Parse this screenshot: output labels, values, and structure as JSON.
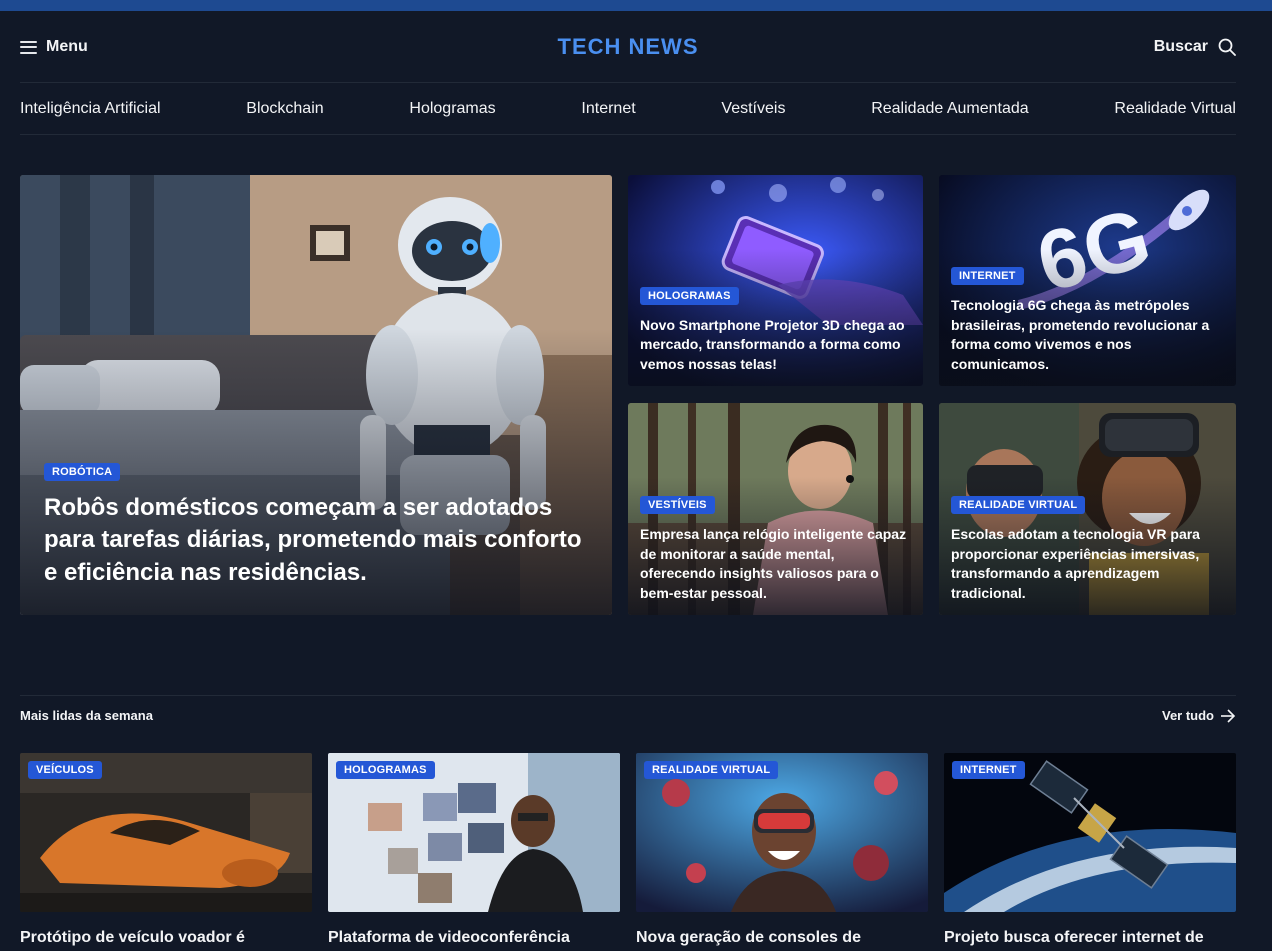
{
  "header": {
    "menu_label": "Menu",
    "logo": "TECH NEWS",
    "search_label": "Buscar"
  },
  "categories": [
    "Inteligência Artificial",
    "Blockchain",
    "Hologramas",
    "Internet",
    "Vestíveis",
    "Realidade Aumentada",
    "Realidade Virtual"
  ],
  "featured": {
    "main": {
      "tag": "ROBÓTICA",
      "title": "Robôs domésticos começam a ser adotados para tarefas diárias, prometendo mais conforto e eficiência nas residências."
    },
    "side": [
      {
        "tag": "HOLOGRAMAS",
        "title": "Novo Smartphone Projetor 3D chega ao mercado, transformando a forma como vemos nossas telas!"
      },
      {
        "tag": "INTERNET",
        "title": "Tecnologia 6G chega às metrópoles brasileiras, prometendo revolucionar a forma como vivemos e nos comunicamos."
      },
      {
        "tag": "VESTÍVEIS",
        "title": "Empresa lança relógio inteligente capaz de monitorar a saúde mental, oferecendo insights valiosos para o bem-estar pessoal."
      },
      {
        "tag": "REALIDADE VIRTUAL",
        "title": "Escolas adotam a tecnologia VR para proporcionar experiências imersivas, transformando a aprendizagem tradicional."
      }
    ]
  },
  "most_read": {
    "title": "Mais lidas da semana",
    "see_all": "Ver tudo",
    "items": [
      {
        "tag": "VEÍCULOS",
        "title": "Protótipo de veículo voador é"
      },
      {
        "tag": "HOLOGRAMAS",
        "title": "Plataforma de videoconferência"
      },
      {
        "tag": "REALIDADE VIRTUAL",
        "title": "Nova geração de consoles de"
      },
      {
        "tag": "INTERNET",
        "title": "Projeto busca oferecer internet de"
      }
    ]
  },
  "image_text": {
    "six_g": "6G"
  },
  "colors": {
    "background": "#111827",
    "accent": "#4a8ff0",
    "badge": "#2457d6",
    "topbar": "#1e4a91"
  }
}
